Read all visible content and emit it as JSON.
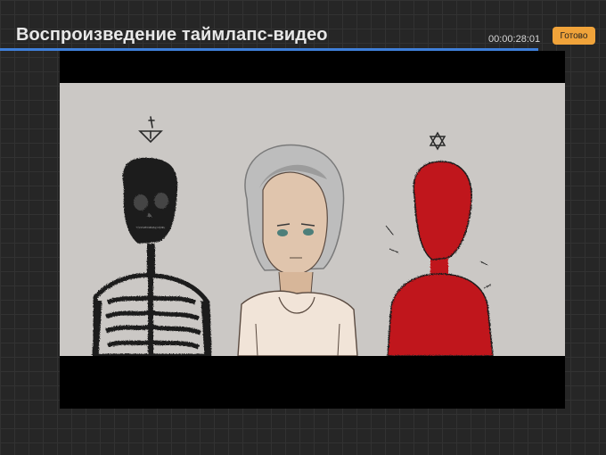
{
  "header": {
    "title": "Воспроизведение таймлапс-видео",
    "timecode": "00:00:28:01",
    "done_label": "Готово"
  },
  "playback": {
    "progress_fraction": 1.0
  },
  "colors": {
    "accent_button": "#f0a33a",
    "progress_bar": "#3f7fd9",
    "canvas_background": "#cbc8c5"
  },
  "icons": [
    "down-arrow-rune-icon",
    "hexagram-star-icon"
  ]
}
